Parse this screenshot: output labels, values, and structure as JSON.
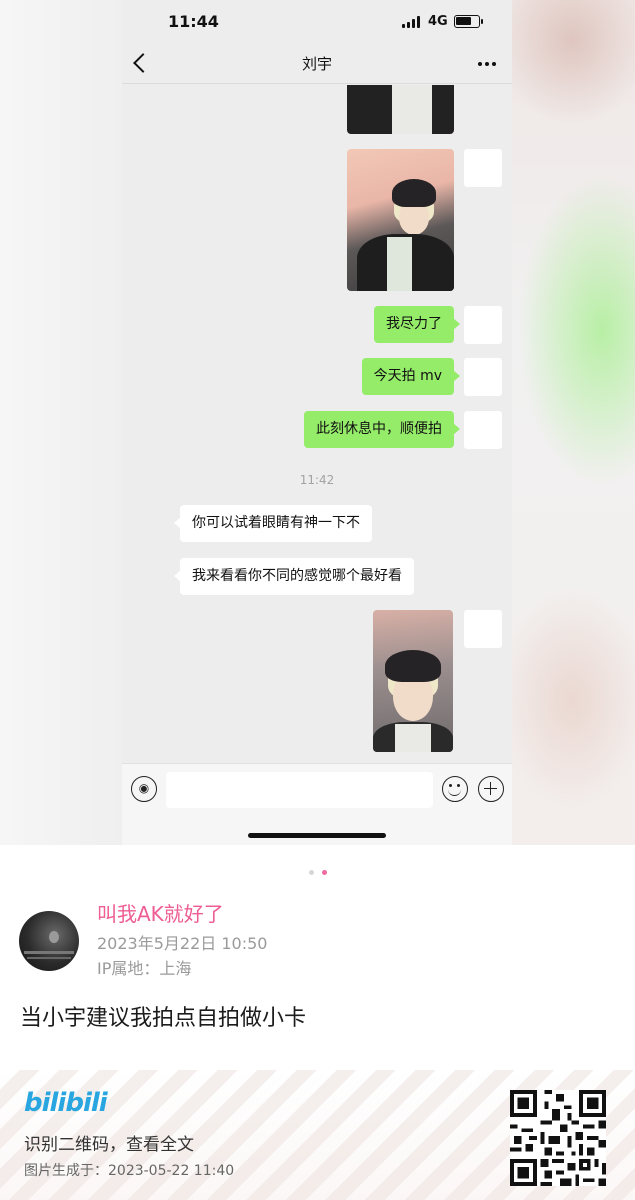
{
  "status_bar": {
    "time": "11:44",
    "network": "4G"
  },
  "chat": {
    "title": "刘宇",
    "messages_out": [
      "我尽力了",
      "今天拍 mv",
      "此刻休息中，顺便拍"
    ],
    "time_separator": "11:42",
    "messages_in": [
      "你可以试着眼睛有神一下不",
      "我来看看你不同的感觉哪个最好看"
    ]
  },
  "icons": [
    "back-icon",
    "more-icon",
    "voice-icon",
    "emoji-icon",
    "plus-icon",
    "signal-icon",
    "battery-icon"
  ],
  "post": {
    "author": "叫我AK就好了",
    "date": "2023年5月22日 10:50",
    "ip": "IP属地：上海",
    "text": "当小宇建议我拍点自拍做小卡"
  },
  "footer": {
    "logo": "bilibili",
    "qr_hint": "识别二维码，查看全文",
    "generated": "图片生成于：2023-05-22 11:40"
  },
  "colors": {
    "bubble_out": "#95ec69",
    "author": "#ee5d93",
    "logo": "#29a6e0",
    "pager_active": "#ef6aa0"
  }
}
